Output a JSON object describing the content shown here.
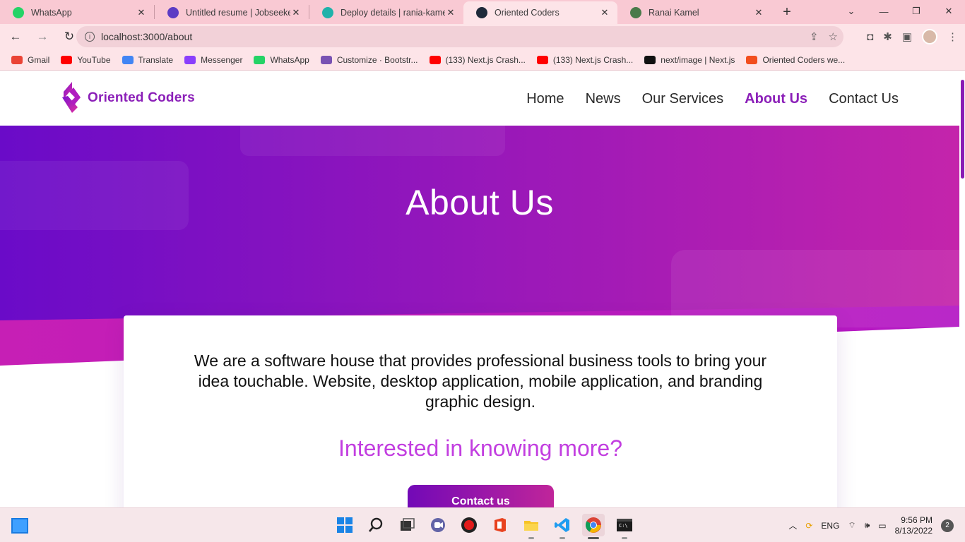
{
  "browser": {
    "tabs": [
      {
        "title": "WhatsApp",
        "icon": "whatsapp-icon",
        "color": "#25d366",
        "active": false
      },
      {
        "title": "Untitled resume | Jobseeker",
        "icon": "jobseeker-icon",
        "color": "#5b3cc4",
        "active": false
      },
      {
        "title": "Deploy details | rania-kamel-",
        "icon": "netlify-icon",
        "color": "#20b2aa",
        "active": false
      },
      {
        "title": "Oriented Coders",
        "icon": "react-icon",
        "color": "#1e2a3a",
        "active": true
      },
      {
        "title": "Ranai Kamel",
        "icon": "page-icon",
        "color": "#4a7a4a",
        "active": false
      }
    ],
    "url": "localhost:3000/about",
    "bookmarks": [
      {
        "label": "Gmail",
        "color": "#ea4335"
      },
      {
        "label": "YouTube",
        "color": "#ff0000"
      },
      {
        "label": "Translate",
        "color": "#4285f4"
      },
      {
        "label": "Messenger",
        "color": "#8a3ffc"
      },
      {
        "label": "WhatsApp",
        "color": "#25d366"
      },
      {
        "label": "Customize · Bootstr...",
        "color": "#7952b3"
      },
      {
        "label": "(133) Next.js Crash...",
        "color": "#ff0000"
      },
      {
        "label": "(133) Next.js Crash...",
        "color": "#ff0000"
      },
      {
        "label": "next/image | Next.js",
        "color": "#111111"
      },
      {
        "label": "Oriented Coders we...",
        "color": "#f24e1e"
      }
    ]
  },
  "site": {
    "logo_text": "Oriented Coders",
    "nav": [
      {
        "label": "Home",
        "active": false
      },
      {
        "label": "News",
        "active": false
      },
      {
        "label": "Our Services",
        "active": false
      },
      {
        "label": "About Us",
        "active": true
      },
      {
        "label": "Contact Us",
        "active": false
      }
    ],
    "hero_title": "About Us",
    "card": {
      "text": "We are a software house that provides professional business tools to bring your idea touchable. Website, desktop application, mobile application, and branding graphic design.",
      "subtitle": "Interested in knowing more?",
      "button_label": "Contact us"
    },
    "colors": {
      "brand": "#8b1fb8",
      "hero_start": "#6a0bc8",
      "hero_end": "#c424ab",
      "subtitle": "#c23ee0"
    }
  },
  "taskbar": {
    "tray_language": "ENG",
    "time": "9:56 PM",
    "date": "8/13/2022",
    "notifications": "2"
  }
}
